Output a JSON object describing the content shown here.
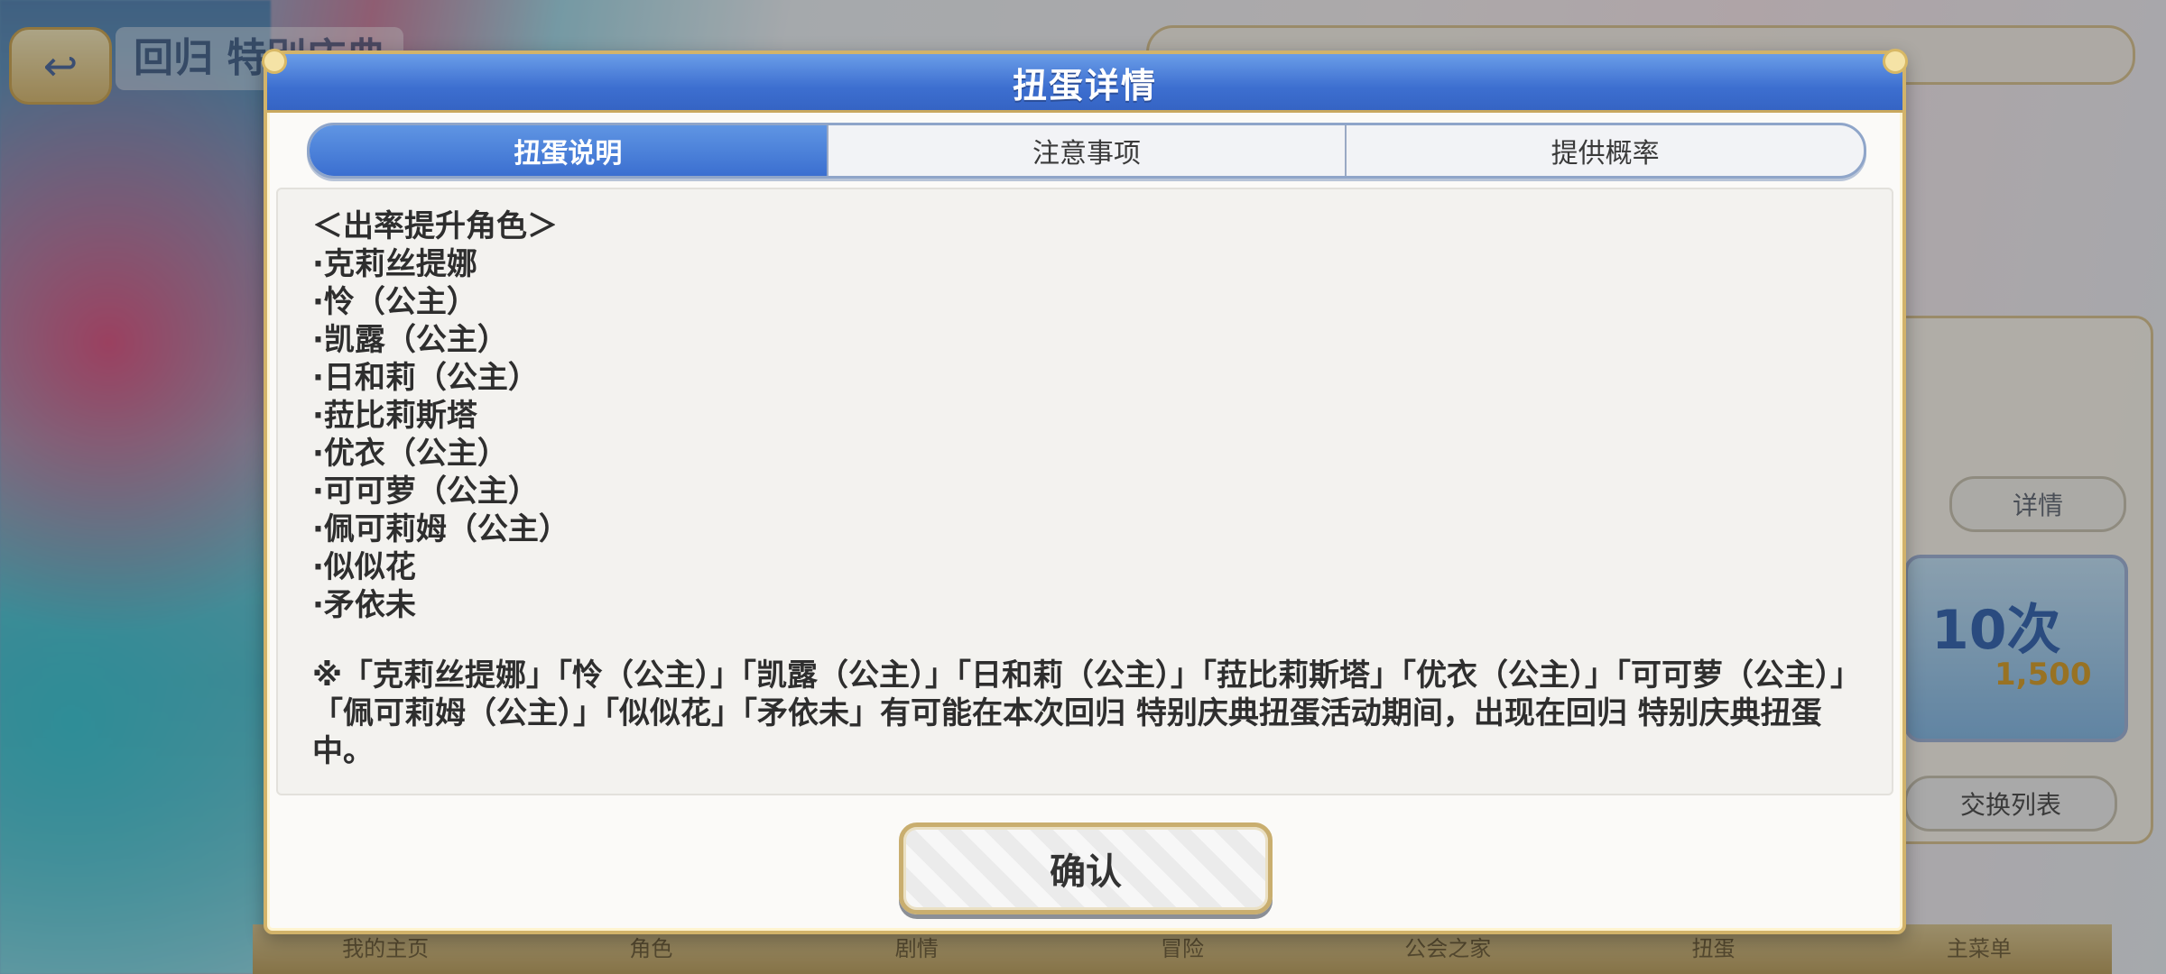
{
  "background": {
    "screen_title": "回归 特别庆典",
    "detail_button": "详情",
    "ten_pull": "10次",
    "ten_pull_cost": "1,500",
    "exchange_button": "交换列表",
    "bottom_nav": [
      "我的主页",
      "角色",
      "剧情",
      "冒险",
      "公会之家",
      "扭蛋",
      "主菜单"
    ]
  },
  "modal": {
    "title": "扭蛋详情",
    "tabs": [
      {
        "label": "扭蛋说明",
        "active": true
      },
      {
        "label": "注意事项",
        "active": false
      },
      {
        "label": "提供概率",
        "active": false
      }
    ],
    "content": {
      "heading": "＜出率提升角色＞",
      "characters": [
        "·克莉丝提娜",
        "·怜（公主）",
        "·凯露（公主）",
        "·日和莉（公主）",
        "·菈比莉斯塔",
        "·优衣（公主）",
        "·可可萝（公主）",
        "·佩可莉姆（公主）",
        "·似似花",
        "·矛依未"
      ],
      "note": "※「克莉丝提娜」「怜（公主）」「凯露（公主）」「日和莉（公主）」「菈比莉斯塔」「优衣（公主）」「可可萝（公主）」「佩可莉姆（公主）」「似似花」「矛依未」有可能在本次回归 特别庆典扭蛋活动期间，出现在回归 特别庆典扭蛋中。"
    },
    "confirm_label": "确认"
  }
}
